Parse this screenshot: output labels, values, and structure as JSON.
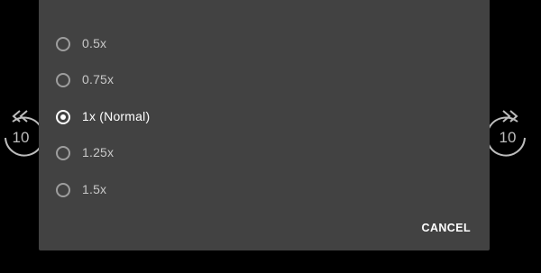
{
  "skip_back": {
    "label": "10",
    "icon": "replay-10-icon"
  },
  "skip_forward": {
    "label": "10",
    "icon": "forward-10-icon"
  },
  "speed_dialog": {
    "options": [
      {
        "label": "0.5x",
        "selected": false
      },
      {
        "label": "0.75x",
        "selected": false
      },
      {
        "label": "1x (Normal)",
        "selected": true
      },
      {
        "label": "1.25x",
        "selected": false
      },
      {
        "label": "1.5x",
        "selected": false
      }
    ],
    "cancel_label": "CANCEL"
  },
  "colors": {
    "background": "#000000",
    "dialog": "#424242",
    "text": "#ffffff",
    "muted": "#c8c8c8"
  }
}
